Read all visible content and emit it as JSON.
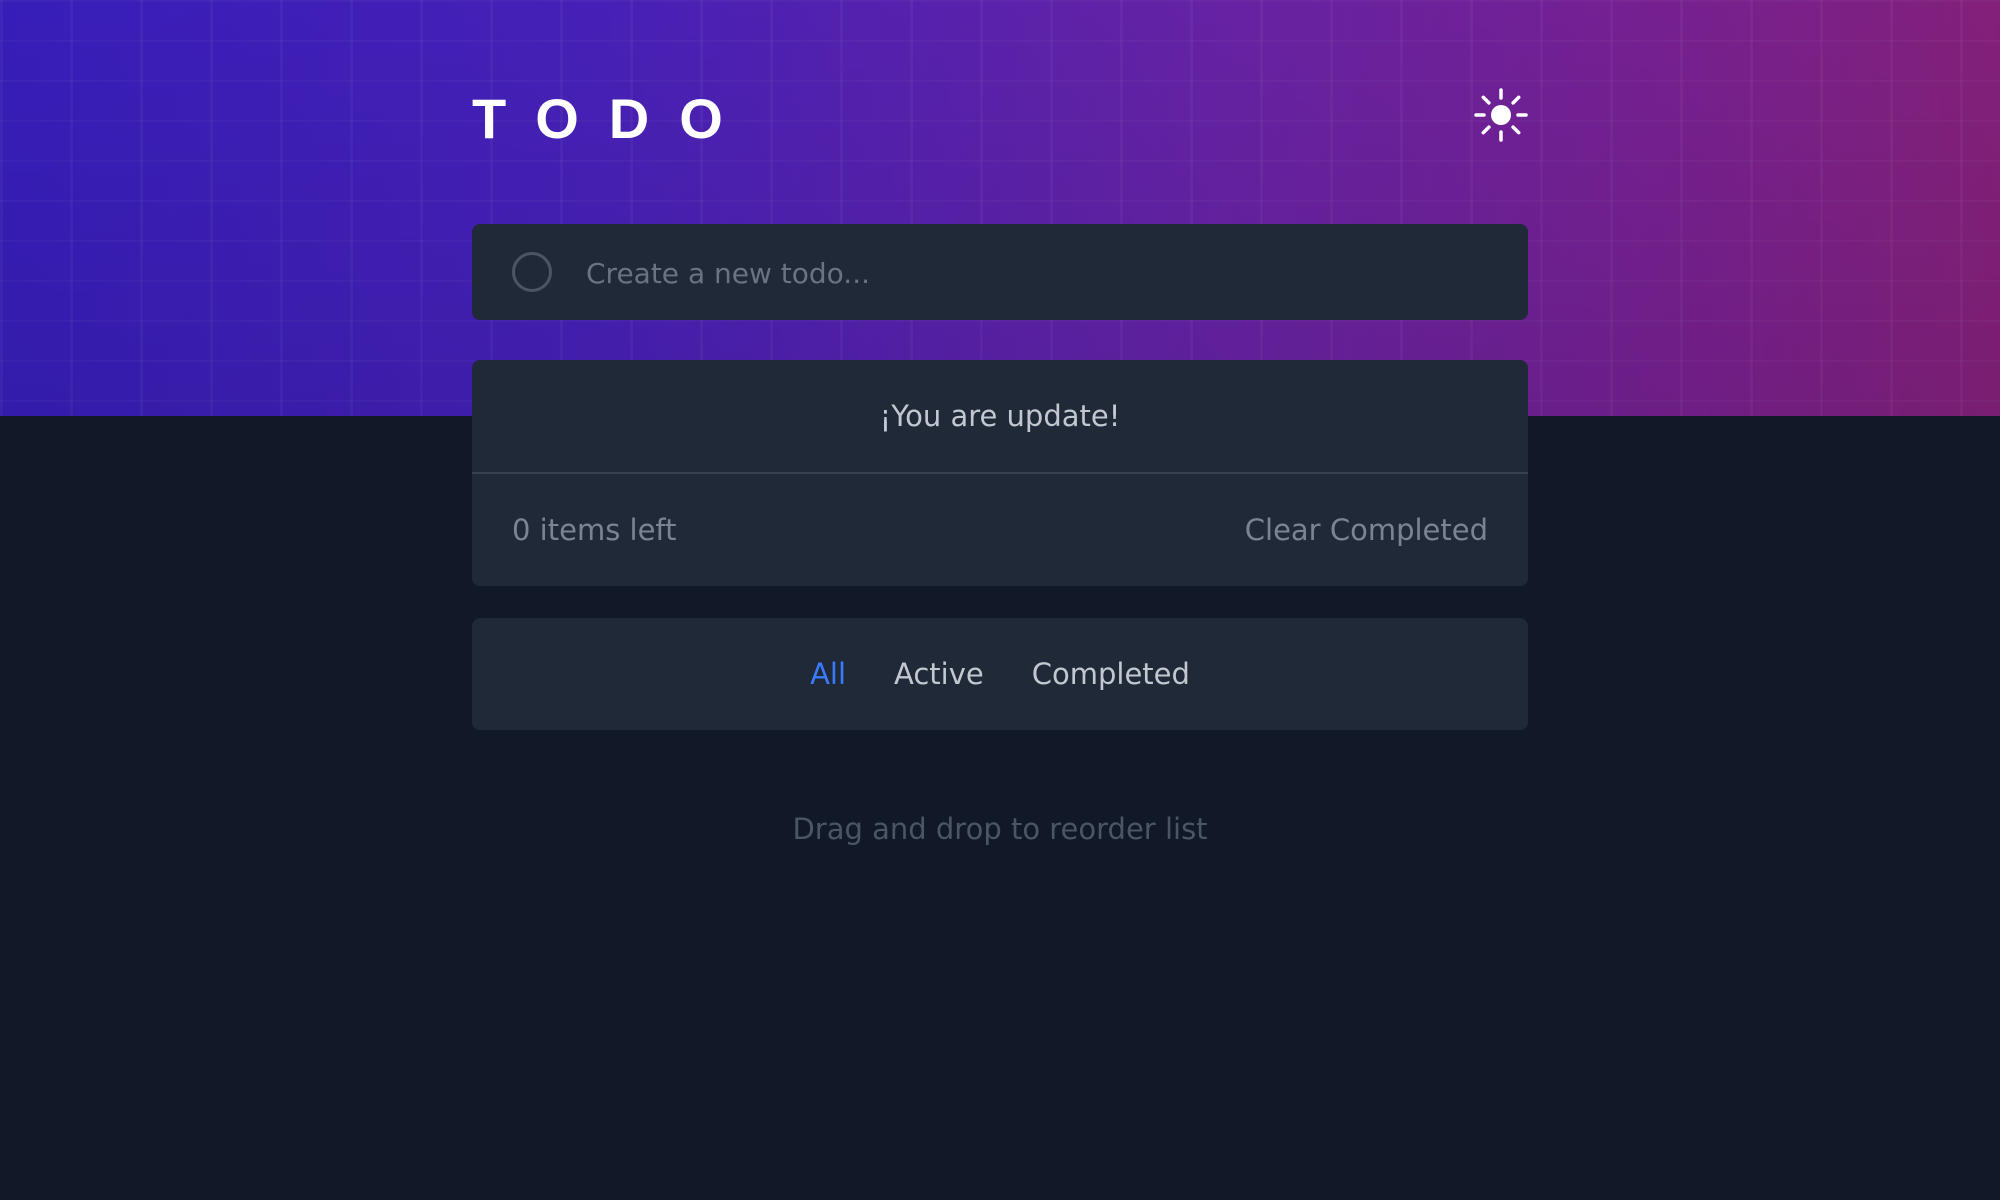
{
  "header": {
    "title": "TODO",
    "theme_toggle_icon": "sun-icon"
  },
  "new_todo": {
    "placeholder": "Create a new todo...",
    "value": ""
  },
  "list": {
    "empty_message": "¡You are update!",
    "items": [],
    "items_left": "0 items left",
    "clear_completed_label": "Clear Completed"
  },
  "filters": {
    "selected": "All",
    "options": [
      "All",
      "Active",
      "Completed"
    ]
  },
  "footer": {
    "hint": "Drag and drop to reorder list"
  },
  "colors": {
    "background": "#111827",
    "card": "#1f2937",
    "accent": "#3a7bfd",
    "gradient_start": "#3a1fc2",
    "gradient_end": "#8a2280"
  }
}
